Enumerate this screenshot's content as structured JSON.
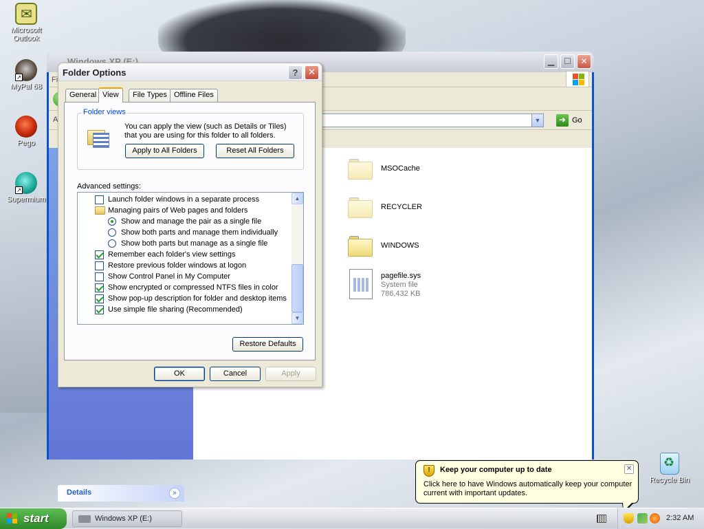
{
  "desktop": {
    "icons": [
      {
        "label": "Microsoft Outlook"
      },
      {
        "label": "MyPal 68"
      },
      {
        "label": "Pego"
      },
      {
        "label": "Supermium"
      },
      {
        "label": "Recycle Bin"
      }
    ]
  },
  "explorer": {
    "title": "Windows XP (E:)",
    "address_label": "A",
    "go_label": "Go",
    "menu_partial": "Fi",
    "details_label": "Details",
    "items": [
      {
        "name": "MSOCache",
        "type": "folder"
      },
      {
        "name": "RECYCLER",
        "type": "folder"
      },
      {
        "name": "WINDOWS",
        "type": "folder"
      },
      {
        "name": "pagefile.sys",
        "type": "file",
        "detail1": "System file",
        "detail2": "786,432 KB"
      }
    ]
  },
  "dialog": {
    "title": "Folder Options",
    "help": "?",
    "close": "✕",
    "tabs": [
      "General",
      "View",
      "File Types",
      "Offline Files"
    ],
    "active_tab": "View",
    "folder_views": {
      "legend": "Folder views",
      "text": "You can apply the view (such as Details or Tiles) that you are using for this folder to all folders.",
      "apply_all": "Apply to All Folders",
      "reset_all": "Reset All Folders"
    },
    "advanced_label": "Advanced settings:",
    "advanced_items": [
      {
        "kind": "checkbox",
        "checked": false,
        "indent": 1,
        "label": "Launch folder windows in a separate process"
      },
      {
        "kind": "folder",
        "indent": 1,
        "label": "Managing pairs of Web pages and folders"
      },
      {
        "kind": "radio",
        "checked": true,
        "indent": 2,
        "label": "Show and manage the pair as a single file"
      },
      {
        "kind": "radio",
        "checked": false,
        "indent": 2,
        "label": "Show both parts and manage them individually"
      },
      {
        "kind": "radio",
        "checked": false,
        "indent": 2,
        "label": "Show both parts but manage as a single file"
      },
      {
        "kind": "checkbox",
        "checked": true,
        "indent": 1,
        "label": "Remember each folder's view settings"
      },
      {
        "kind": "checkbox",
        "checked": false,
        "indent": 1,
        "label": "Restore previous folder windows at logon"
      },
      {
        "kind": "checkbox",
        "checked": false,
        "indent": 1,
        "label": "Show Control Panel in My Computer"
      },
      {
        "kind": "checkbox",
        "checked": true,
        "indent": 1,
        "label": "Show encrypted or compressed NTFS files in color"
      },
      {
        "kind": "checkbox",
        "checked": true,
        "indent": 1,
        "label": "Show pop-up description for folder and desktop items"
      },
      {
        "kind": "checkbox",
        "checked": true,
        "indent": 1,
        "label": "Use simple file sharing (Recommended)"
      }
    ],
    "restore_defaults": "Restore Defaults",
    "ok": "OK",
    "cancel": "Cancel",
    "apply": "Apply"
  },
  "taskbar": {
    "start_label": "start",
    "task_item": "Windows XP (E:)",
    "clock": "2:32 AM"
  },
  "balloon": {
    "title": "Keep your computer up to date",
    "text": "Click here to have Windows automatically keep your computer current with important updates.",
    "close": "✕"
  }
}
